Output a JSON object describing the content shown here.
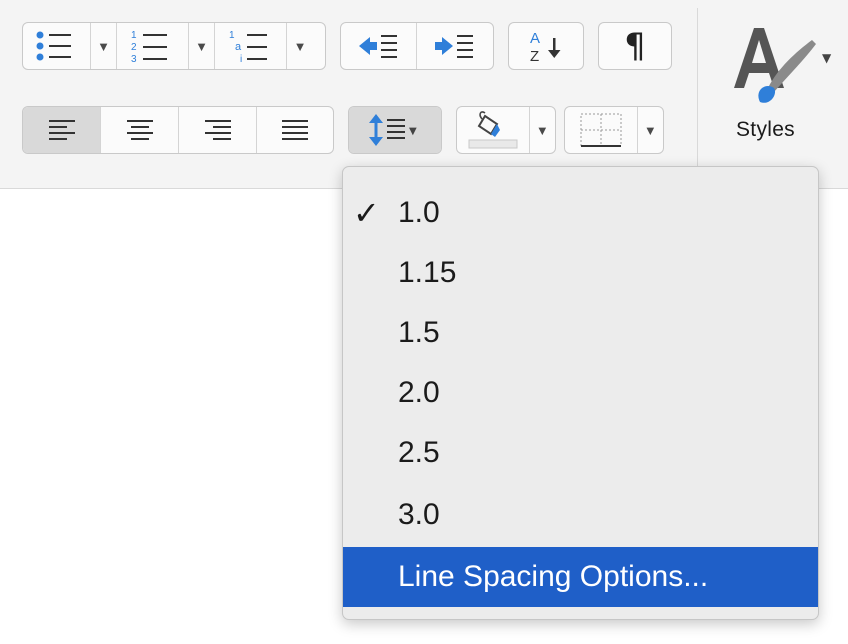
{
  "toolbar": {
    "styles_label": "Styles",
    "sort_label_top": "A",
    "sort_label_bottom": "Z",
    "pilcrow": "¶"
  },
  "line_spacing_menu": {
    "checked_value": "1.0",
    "items": [
      {
        "label": "1.0",
        "checked": true
      },
      {
        "label": "1.15",
        "checked": false
      },
      {
        "label": "1.5",
        "checked": false
      },
      {
        "label": "2.0",
        "checked": false
      },
      {
        "label": "2.5",
        "checked": false
      },
      {
        "label": "3.0",
        "checked": false
      },
      {
        "label": "Line Spacing Options...",
        "highlighted": true
      }
    ]
  },
  "colors": {
    "accent_blue": "#2f7fd9",
    "menu_highlight": "#1f5fc8"
  },
  "icons": [
    "bullets-icon",
    "numbering-icon",
    "multilevel-list-icon",
    "decrease-indent-icon",
    "increase-indent-icon",
    "sort-icon",
    "pilcrow-icon",
    "styles-brush-icon",
    "align-left-icon",
    "align-center-icon",
    "align-right-icon",
    "justify-icon",
    "line-spacing-icon",
    "shading-icon",
    "borders-icon"
  ]
}
